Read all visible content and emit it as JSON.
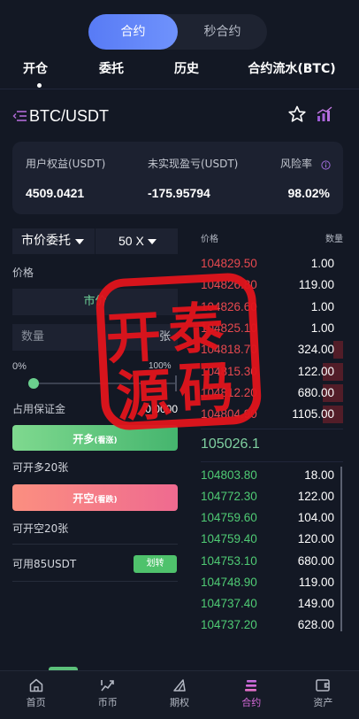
{
  "colors": {
    "background": "#131824",
    "card": "#1c2130",
    "accent_blue": "#587bf5",
    "ask_red": "#e8494f",
    "bid_green": "#4fcb74",
    "long_button": "#45b56e",
    "short_button": "#ef6a90",
    "active_nav": "#d46ad8",
    "stamp_red": "#e2141c"
  },
  "mode_toggle": {
    "active_label": "合约",
    "inactive_label": "秒合约"
  },
  "tabs": [
    {
      "label": "开仓",
      "active": true
    },
    {
      "label": "委托",
      "active": false
    },
    {
      "label": "历史",
      "active": false
    },
    {
      "label": "合约流水(BTC)",
      "active": false
    }
  ],
  "pair": {
    "symbol": "BTC/USDT",
    "menu_icon": "list-collapse-icon",
    "favorite_icon": "star-outline-icon",
    "chart_icon": "bar-chart-icon"
  },
  "account": {
    "equity_label": "用户权益(USDT)",
    "equity_value": "4509.0421",
    "pnl_label": "未实现盈亏(USDT)",
    "pnl_value": "-175.95794",
    "risk_label": "风险率",
    "risk_value": "98.02%",
    "info_icon": "info-icon"
  },
  "order_form": {
    "order_type": "市价委托",
    "leverage": "50 X",
    "price_label": "价格",
    "price_value": "市价",
    "quantity_placeholder": "数量",
    "quantity_unit": "张",
    "slider_min": "0%",
    "slider_max": "100%",
    "slider_value": 0,
    "margin_label": "占用保证金",
    "margin_value": "0.0000",
    "long_button": "开多",
    "long_hint": "(看涨)",
    "long_available": "可开多20张",
    "short_button": "开空",
    "short_hint": "(看跌)",
    "short_available": "可开空20张",
    "available_balance": "可用85USDT",
    "transfer_button": "划转"
  },
  "order_book": {
    "price_header": "价格",
    "qty_header": "数量",
    "asks": [
      {
        "price": "104829.50",
        "qty": "1.00",
        "depth": 0
      },
      {
        "price": "104826.80",
        "qty": "119.00",
        "depth": 0
      },
      {
        "price": "104826.60",
        "qty": "1.00",
        "depth": 0
      },
      {
        "price": "104825.10",
        "qty": "1.00",
        "depth": 0
      },
      {
        "price": "104818.70",
        "qty": "324.00",
        "depth": 0.07
      },
      {
        "price": "104815.30",
        "qty": "122.00",
        "depth": 0.14
      },
      {
        "price": "104812.20",
        "qty": "680.00",
        "depth": 0.14
      },
      {
        "price": "104804.90",
        "qty": "1105.00",
        "depth": 0.14
      }
    ],
    "last_price": "105026.1",
    "bids": [
      {
        "price": "104803.80",
        "qty": "18.00"
      },
      {
        "price": "104772.30",
        "qty": "122.00"
      },
      {
        "price": "104759.60",
        "qty": "104.00"
      },
      {
        "price": "104759.40",
        "qty": "120.00"
      },
      {
        "price": "104753.10",
        "qty": "680.00"
      },
      {
        "price": "104748.90",
        "qty": "119.00"
      },
      {
        "price": "104737.40",
        "qty": "149.00"
      },
      {
        "price": "104737.20",
        "qty": "628.00"
      }
    ]
  },
  "bottom_nav": [
    {
      "label": "首页",
      "icon": "home-icon",
      "active": false
    },
    {
      "label": "币币",
      "icon": "spot-trend-icon",
      "active": false
    },
    {
      "label": "期权",
      "icon": "options-icon",
      "active": false
    },
    {
      "label": "合约",
      "icon": "contract-icon",
      "active": true
    },
    {
      "label": "资产",
      "icon": "wallet-icon",
      "active": false
    }
  ],
  "stamp": {
    "chars": [
      "开",
      "泰",
      "源",
      "码"
    ]
  }
}
